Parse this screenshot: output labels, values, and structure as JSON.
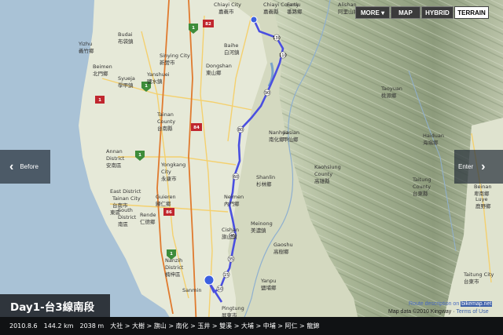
{
  "map_types": [
    {
      "label": "MORE",
      "id": "more",
      "active": false
    },
    {
      "label": "MAP",
      "id": "map",
      "active": false
    },
    {
      "label": "HYBRID",
      "id": "hybrid",
      "active": false
    },
    {
      "label": "TERRAIN",
      "id": "terrain",
      "active": true
    }
  ],
  "nav": {
    "before": "Before",
    "enter": "Enter"
  },
  "title": "Day1-台3線南段",
  "info": {
    "date": "2010.8.6",
    "distance": "144.2 km",
    "elevation": "2038 m",
    "route": "大社 > 大樹 > 旗山 > 南化 > 玉井 > 雙溪 > 大埔 > 中埔 > 阿仁 > 龍錦"
  },
  "attribution": {
    "route_prefix": "Route description on ",
    "route_link": "bikemap.net",
    "mapdata": "Map data ©2010 Kingway · ",
    "terms": "Terms of Use"
  },
  "colors": {
    "route": "#4a4fe0",
    "highway_red": "#c0262e",
    "marker_green": "#3d8c3a",
    "accent_blue": "#2d54a8"
  },
  "map_labels": [
    {
      "text": "Chiayi City"
    },
    {
      "text": "嘉義市"
    },
    {
      "text": "Chiayi County"
    },
    {
      "text": "嘉義縣"
    },
    {
      "text": "Fanlu"
    },
    {
      "text": "番路鄉"
    },
    {
      "text": "Alishan"
    },
    {
      "text": "阿里山鄉"
    },
    {
      "text": "Budai"
    },
    {
      "text": "布袋鎮"
    },
    {
      "text": "Yizhu"
    },
    {
      "text": "義竹鄉"
    },
    {
      "text": "Sinying City"
    },
    {
      "text": "新營市"
    },
    {
      "text": "Baihe"
    },
    {
      "text": "白河鎮"
    },
    {
      "text": "Beimen"
    },
    {
      "text": "北門鄉"
    },
    {
      "text": "Syueja"
    },
    {
      "text": "學甲鎮"
    },
    {
      "text": "Yanshuei"
    },
    {
      "text": "鹽水鎮"
    },
    {
      "text": "Dongshan"
    },
    {
      "text": "東山鄉"
    },
    {
      "text": "Tainan"
    },
    {
      "text": "County"
    },
    {
      "text": "台南縣"
    },
    {
      "text": "Taoyuan"
    },
    {
      "text": "桃源鄉"
    },
    {
      "text": "Haiduan"
    },
    {
      "text": "海端鄉"
    },
    {
      "text": "Nanhua"
    },
    {
      "text": "南化鄉"
    },
    {
      "text": "Jiasian"
    },
    {
      "text": "甲仙鄉"
    },
    {
      "text": "Kaohsiung"
    },
    {
      "text": "County"
    },
    {
      "text": "高雄縣"
    },
    {
      "text": "Taitung"
    },
    {
      "text": "County"
    },
    {
      "text": "台東縣"
    },
    {
      "text": "Annan"
    },
    {
      "text": "District"
    },
    {
      "text": "安南區"
    },
    {
      "text": "Yongkang"
    },
    {
      "text": "City"
    },
    {
      "text": "永康市"
    },
    {
      "text": "Tainan City"
    },
    {
      "text": "台南市"
    },
    {
      "text": "East District"
    },
    {
      "text": "東區"
    },
    {
      "text": "South"
    },
    {
      "text": "District"
    },
    {
      "text": "南區"
    },
    {
      "text": "Guieren"
    },
    {
      "text": "歸仁鄉"
    },
    {
      "text": "Rende"
    },
    {
      "text": "仁德鄉"
    },
    {
      "text": "Neimen"
    },
    {
      "text": "內門鄉"
    },
    {
      "text": "Shanlin"
    },
    {
      "text": "杉林鄉"
    },
    {
      "text": "Cishan"
    },
    {
      "text": "旗山鎮"
    },
    {
      "text": "Meinong"
    },
    {
      "text": "美濃鎮"
    },
    {
      "text": "Gaoshu"
    },
    {
      "text": "高樹鄉"
    },
    {
      "text": "Yanpu"
    },
    {
      "text": "鹽埔鄉"
    },
    {
      "text": "Nanzih"
    },
    {
      "text": "District"
    },
    {
      "text": "楠梓區"
    },
    {
      "text": "Sanmin"
    },
    {
      "text": "Pingtung"
    },
    {
      "text": "屏東市"
    },
    {
      "text": "Taitung City"
    },
    {
      "text": "台東市"
    },
    {
      "text": "Beinan"
    },
    {
      "text": "卑南鄉"
    },
    {
      "text": "Luye"
    },
    {
      "text": "鹿野鄉"
    }
  ]
}
